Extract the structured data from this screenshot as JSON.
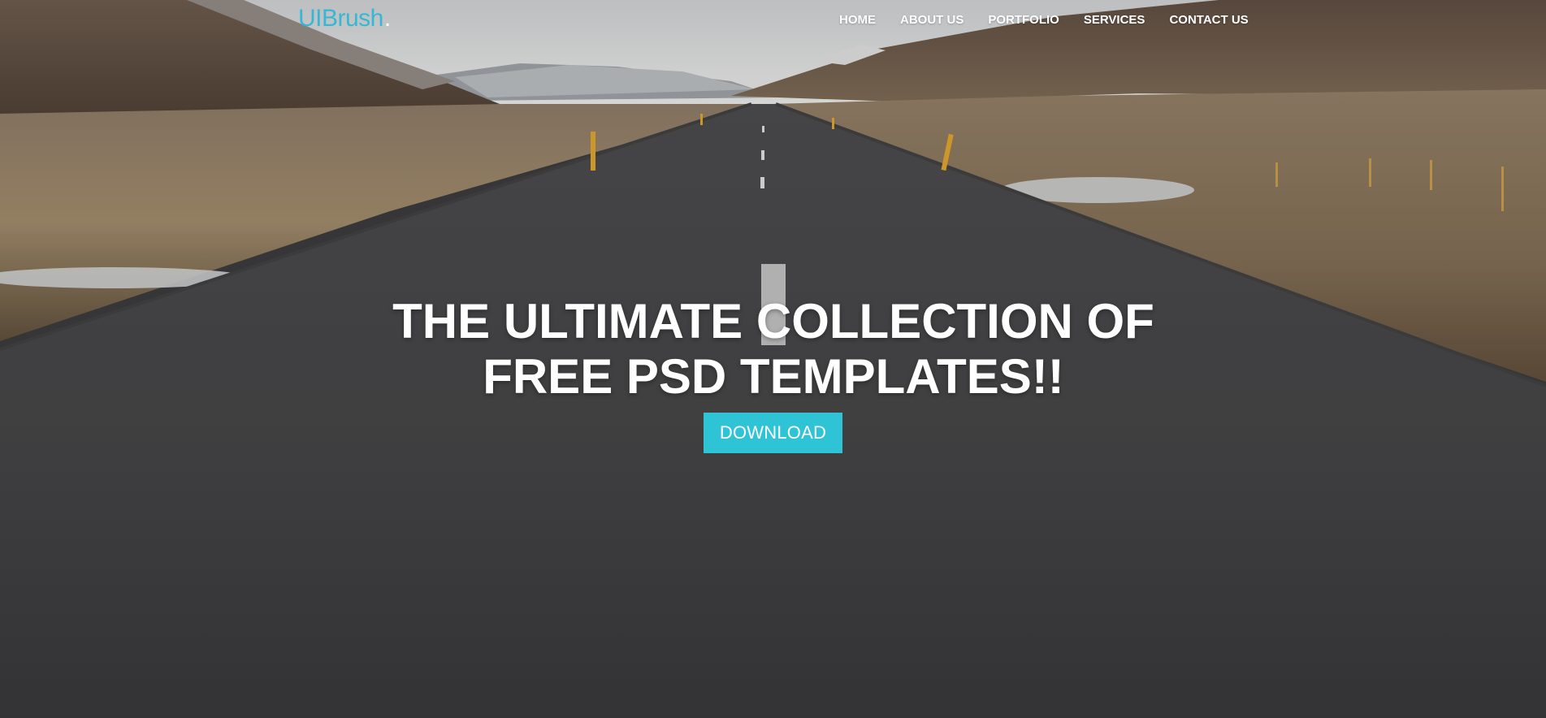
{
  "brand": {
    "name": "UIBrush",
    "dot": ".",
    "color": "#35b7d5"
  },
  "nav": {
    "items": [
      {
        "label": "HOME"
      },
      {
        "label": "ABOUT US"
      },
      {
        "label": "PORTFOLIO"
      },
      {
        "label": "SERVICES"
      },
      {
        "label": "CONTACT US"
      }
    ]
  },
  "hero": {
    "headline_line1": "THE ULTIMATE COLLECTION OF",
    "headline_line2": "FREE PSD TEMPLATES!!",
    "download_label": "DOWNLOAD",
    "button_color": "#2fc3d6",
    "background_subject": "empty asphalt road through highland valley"
  }
}
